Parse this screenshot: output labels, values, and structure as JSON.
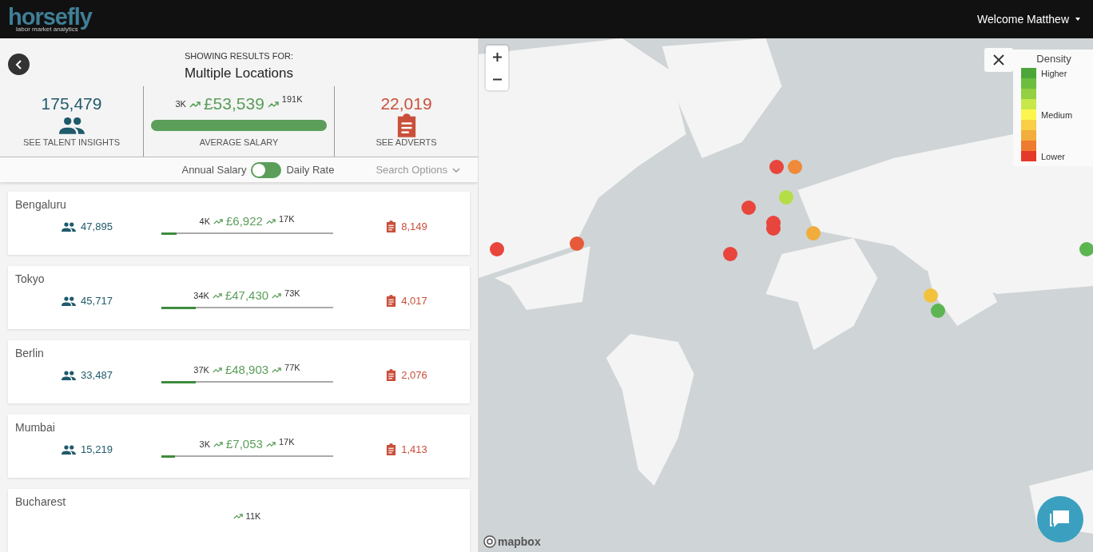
{
  "header": {
    "logo": "horsefly",
    "tagline": "labor market analytics",
    "user_menu": "Welcome Matthew"
  },
  "summary": {
    "caption": "SHOWING RESULTS FOR:",
    "title": "Multiple Locations",
    "talent": {
      "value": "175,479",
      "label": "SEE TALENT INSIGHTS"
    },
    "salary": {
      "min": "3K",
      "average": "£53,539",
      "max": "191K",
      "level": 1.0,
      "label": "AVERAGE SALARY"
    },
    "adverts": {
      "value": "22,019",
      "label": "SEE ADVERTS"
    }
  },
  "rate_toggle": {
    "left_label": "Annual Salary",
    "right_label": "Daily Rate",
    "on": false
  },
  "search_options": "Search Options",
  "locations": [
    {
      "name": "Bengaluru",
      "talent": "47,895",
      "min": "4K",
      "average": "£6,922",
      "max": "17K",
      "level": 0.09,
      "adverts": "8,149"
    },
    {
      "name": "Tokyo",
      "talent": "45,717",
      "min": "34K",
      "average": "£47,430",
      "max": "73K",
      "level": 0.2,
      "adverts": "4,017"
    },
    {
      "name": "Berlin",
      "talent": "33,487",
      "min": "37K",
      "average": "£48,903",
      "max": "77K",
      "level": 0.2,
      "adverts": "2,076"
    },
    {
      "name": "Mumbai",
      "talent": "15,219",
      "min": "3K",
      "average": "£7,053",
      "max": "17K",
      "level": 0.08,
      "adverts": "1,413"
    },
    {
      "name": "Bucharest",
      "max": "11K"
    }
  ],
  "map": {
    "markers": [
      {
        "color": "#e8453c"
      },
      {
        "color": "#e65a3a"
      },
      {
        "color": "#e8453c"
      },
      {
        "color": "#e8453c"
      },
      {
        "color": "#e8453c"
      },
      {
        "color": "#e8453c"
      },
      {
        "color": "#ef8a3a"
      },
      {
        "color": "#b5dd45"
      },
      {
        "color": "#e8453c"
      },
      {
        "color": "#f0ad3c"
      },
      {
        "color": "#f2c23e"
      },
      {
        "color": "#5cb551"
      },
      {
        "color": "#5cb551"
      }
    ],
    "legend": {
      "title": "Density",
      "scale": [
        {
          "color": "#4ca63a",
          "label": "Higher"
        },
        {
          "color": "#6dbd3e"
        },
        {
          "color": "#94d042"
        },
        {
          "color": "#c8e84a"
        },
        {
          "color": "#fbf64f",
          "label": "Medium"
        },
        {
          "color": "#f8cf45"
        },
        {
          "color": "#f2ad3c"
        },
        {
          "color": "#ee7c30"
        },
        {
          "color": "#e5392a",
          "label": "Lower"
        }
      ]
    },
    "attribution": "mapbox"
  }
}
